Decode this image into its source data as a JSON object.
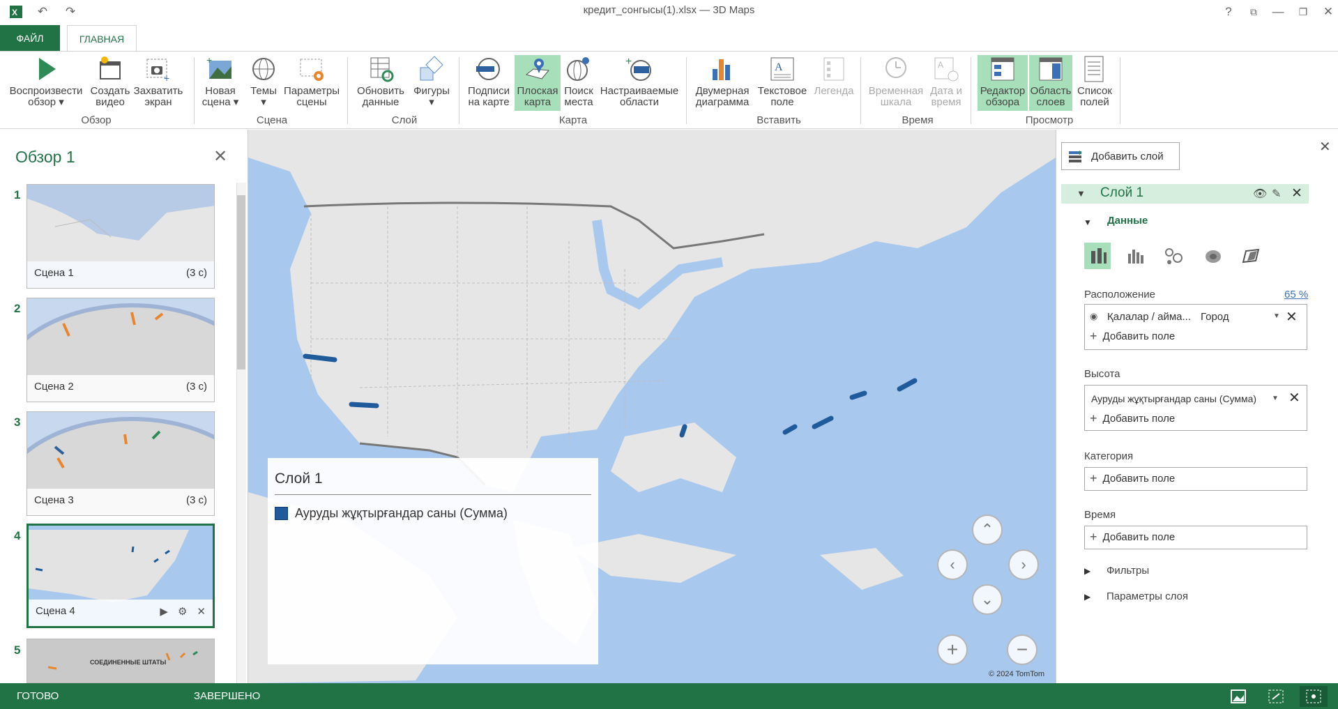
{
  "window": {
    "title": "кредит_сонгысы(1).xlsx — 3D Maps",
    "help": "?",
    "restore_ribbon": "⧉",
    "minimize": "—",
    "maximize": "❐",
    "close": "✕",
    "undo_icon": "undo-icon",
    "redo_icon": "redo-icon"
  },
  "tabs": {
    "file": "ФАЙЛ",
    "home": "ГЛАВНАЯ"
  },
  "ribbon": {
    "buttons": [
      {
        "label": "Воспроизвести\nобзор ▾"
      },
      {
        "label": "Создать\nвидео"
      },
      {
        "label": "Захватить\nэкран"
      },
      {
        "label": "Новая\nсцена ▾"
      },
      {
        "label": "Темы\n▾"
      },
      {
        "label": "Параметры\nсцены"
      },
      {
        "label": "Обновить\nданные"
      },
      {
        "label": "Фигуры\n▾"
      },
      {
        "label": "Подписи\nна карте"
      },
      {
        "label": "Плоская\nкарта"
      },
      {
        "label": "Поиск\nместа"
      },
      {
        "label": "Настраиваемые\nобласти"
      },
      {
        "label": "Двумерная\nдиаграмма"
      },
      {
        "label": "Текстовое\nполе"
      },
      {
        "label": "Легенда"
      },
      {
        "label": "Временная\nшкала"
      },
      {
        "label": "Дата и\nвремя"
      },
      {
        "label": "Редактор\nобзора"
      },
      {
        "label": "Область\nслоев"
      },
      {
        "label": "Список\nполей"
      }
    ],
    "groups": [
      "Обзор",
      "Сцена",
      "Слой",
      "Карта",
      "Вставить",
      "Время",
      "Просмотр"
    ]
  },
  "tour": {
    "title": "Обзор 1",
    "close": "✕",
    "scenes": [
      {
        "num": "1",
        "name": "Сцена 1",
        "duration": "(3 с)"
      },
      {
        "num": "2",
        "name": "Сцена 2",
        "duration": "(3 с)"
      },
      {
        "num": "3",
        "name": "Сцена 3",
        "duration": "(3 с)"
      },
      {
        "num": "4",
        "name": "Сцена 4",
        "duration": ""
      },
      {
        "num": "5",
        "name": "",
        "duration": ""
      }
    ],
    "scene5_caption": "СОЕДИНЕННЫЕ ШТАТЫ"
  },
  "map": {
    "legend_title": "Слой 1",
    "legend_item": "Ауруды жұқтырғандар саны (Сумма)",
    "series_color": "#1f5a9a",
    "copyright": "© 2024 TomTom"
  },
  "layer_pane": {
    "add_layer": "Добавить слой",
    "layer_name": "Слой 1",
    "data_header": "Данные",
    "location_label": "Расположение",
    "location_pct": "65 %",
    "location_field": "Қалалар / айма...",
    "location_type": "Город",
    "add_field": "Добавить поле",
    "height_label": "Высота",
    "height_field": "Ауруды жұқтырғандар саны (Сумма)",
    "category_label": "Категория",
    "time_label": "Время",
    "filters": "Фильтры",
    "layer_options": "Параметры слоя",
    "close": "✕"
  },
  "status": {
    "ready": "ГОТОВО",
    "done": "ЗАВЕРШЕНО"
  },
  "colors": {
    "accent": "#217346",
    "active_bg": "#a6dfb9"
  }
}
